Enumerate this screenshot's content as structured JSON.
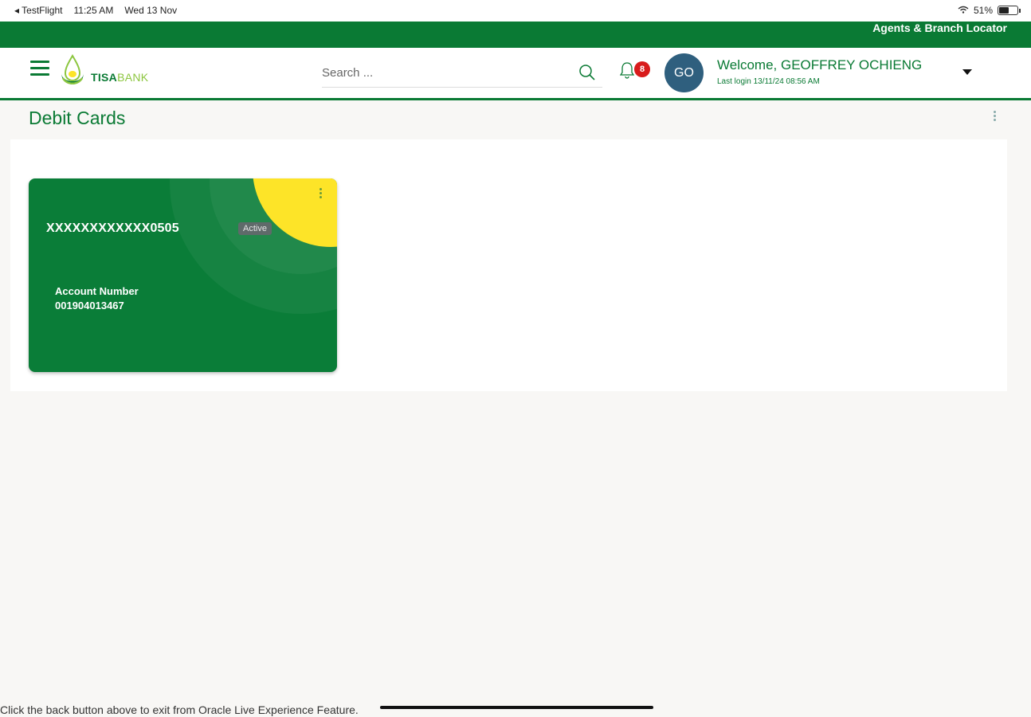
{
  "statusbar": {
    "back_app": "TestFlight",
    "time": "11:25 AM",
    "date": "Wed 13 Nov",
    "battery": "51%"
  },
  "topbar": {
    "link": "Agents & Branch Locator"
  },
  "header": {
    "logo_part1": "TISA",
    "logo_part2": "BANK",
    "search_placeholder": "Search ...",
    "notification_count": "8",
    "avatar_initials": "GO",
    "welcome": "Welcome, GEOFFREY OCHIENG",
    "last_login": "Last login 13/11/24 08:56 AM"
  },
  "page": {
    "title": "Debit Cards"
  },
  "card": {
    "number": "XXXXXXXXXXXX0505",
    "status": "Active",
    "account_label": "Account Number",
    "account_number": "001904013467"
  },
  "footer": {
    "text": "Click the back button above to exit from Oracle Live Experience Feature."
  },
  "colors": {
    "brand_green": "#0a7a34",
    "card_yellow": "#fde428",
    "badge_red": "#d81b1b"
  }
}
